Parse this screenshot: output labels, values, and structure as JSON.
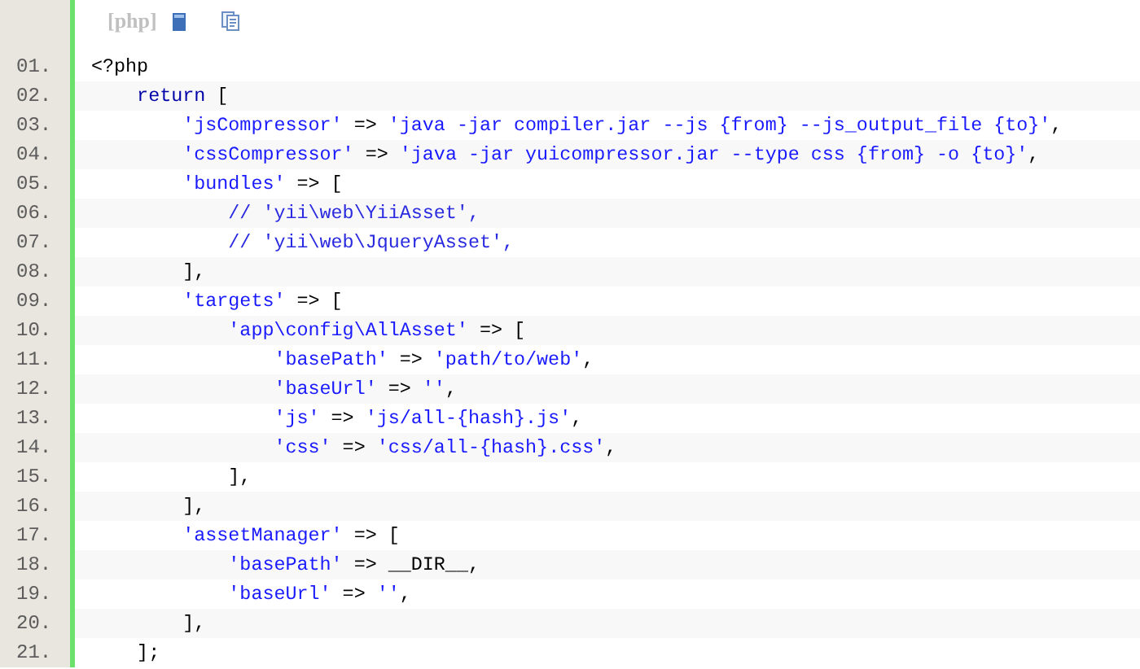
{
  "toolbar": {
    "language": "[php]"
  },
  "lines": [
    {
      "number": "01.",
      "tokens": [
        {
          "kind": "plain",
          "text": "<?php"
        }
      ]
    },
    {
      "number": "02.",
      "tokens": [
        {
          "kind": "keyword",
          "text": "    return"
        },
        {
          "kind": "plain",
          "text": " ["
        }
      ]
    },
    {
      "number": "03.",
      "tokens": [
        {
          "kind": "string",
          "text": "        'jsCompressor'"
        },
        {
          "kind": "plain",
          "text": " => "
        },
        {
          "kind": "string",
          "text": "'java -jar compiler.jar --js {from} --js_output_file {to}'"
        },
        {
          "kind": "plain",
          "text": ","
        }
      ]
    },
    {
      "number": "04.",
      "tokens": [
        {
          "kind": "string",
          "text": "        'cssCompressor'"
        },
        {
          "kind": "plain",
          "text": " => "
        },
        {
          "kind": "string",
          "text": "'java -jar yuicompressor.jar --type css {from} -o {to}'"
        },
        {
          "kind": "plain",
          "text": ","
        }
      ]
    },
    {
      "number": "05.",
      "tokens": [
        {
          "kind": "string",
          "text": "        'bundles'"
        },
        {
          "kind": "plain",
          "text": " => ["
        }
      ]
    },
    {
      "number": "06.",
      "tokens": [
        {
          "kind": "comment",
          "text": "            // 'yii\\web\\YiiAsset',"
        }
      ]
    },
    {
      "number": "07.",
      "tokens": [
        {
          "kind": "comment",
          "text": "            // 'yii\\web\\JqueryAsset',"
        }
      ]
    },
    {
      "number": "08.",
      "tokens": [
        {
          "kind": "plain",
          "text": "        ],"
        }
      ]
    },
    {
      "number": "09.",
      "tokens": [
        {
          "kind": "string",
          "text": "        'targets'"
        },
        {
          "kind": "plain",
          "text": " => ["
        }
      ]
    },
    {
      "number": "10.",
      "tokens": [
        {
          "kind": "string",
          "text": "            'app\\config\\AllAsset'"
        },
        {
          "kind": "plain",
          "text": " => ["
        }
      ]
    },
    {
      "number": "11.",
      "tokens": [
        {
          "kind": "string",
          "text": "                'basePath'"
        },
        {
          "kind": "plain",
          "text": " => "
        },
        {
          "kind": "string",
          "text": "'path/to/web'"
        },
        {
          "kind": "plain",
          "text": ","
        }
      ]
    },
    {
      "number": "12.",
      "tokens": [
        {
          "kind": "string",
          "text": "                'baseUrl'"
        },
        {
          "kind": "plain",
          "text": " => "
        },
        {
          "kind": "string",
          "text": "''"
        },
        {
          "kind": "plain",
          "text": ","
        }
      ]
    },
    {
      "number": "13.",
      "tokens": [
        {
          "kind": "string",
          "text": "                'js'"
        },
        {
          "kind": "plain",
          "text": " => "
        },
        {
          "kind": "string",
          "text": "'js/all-{hash}.js'"
        },
        {
          "kind": "plain",
          "text": ","
        }
      ]
    },
    {
      "number": "14.",
      "tokens": [
        {
          "kind": "string",
          "text": "                'css'"
        },
        {
          "kind": "plain",
          "text": " => "
        },
        {
          "kind": "string",
          "text": "'css/all-{hash}.css'"
        },
        {
          "kind": "plain",
          "text": ","
        }
      ]
    },
    {
      "number": "15.",
      "tokens": [
        {
          "kind": "plain",
          "text": "            ],"
        }
      ]
    },
    {
      "number": "16.",
      "tokens": [
        {
          "kind": "plain",
          "text": "        ],"
        }
      ]
    },
    {
      "number": "17.",
      "tokens": [
        {
          "kind": "string",
          "text": "        'assetManager'"
        },
        {
          "kind": "plain",
          "text": " => ["
        }
      ]
    },
    {
      "number": "18.",
      "tokens": [
        {
          "kind": "string",
          "text": "            'basePath'"
        },
        {
          "kind": "plain",
          "text": " => __DIR__,"
        }
      ]
    },
    {
      "number": "19.",
      "tokens": [
        {
          "kind": "string",
          "text": "            'baseUrl'"
        },
        {
          "kind": "plain",
          "text": " => "
        },
        {
          "kind": "string",
          "text": "''"
        },
        {
          "kind": "plain",
          "text": ","
        }
      ]
    },
    {
      "number": "20.",
      "tokens": [
        {
          "kind": "plain",
          "text": "        ],"
        }
      ]
    },
    {
      "number": "21.",
      "tokens": [
        {
          "kind": "plain",
          "text": "    ];"
        }
      ]
    }
  ]
}
